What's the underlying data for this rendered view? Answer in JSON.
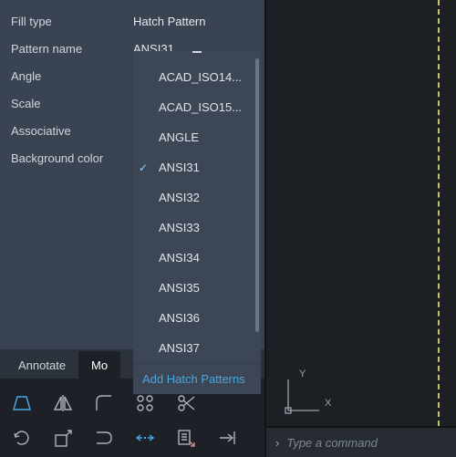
{
  "props": {
    "fill_type_label": "Fill type",
    "fill_type_value": "Hatch Pattern",
    "pattern_name_label": "Pattern name",
    "pattern_name_value": "ANSI31",
    "angle_label": "Angle",
    "scale_label": "Scale",
    "associative_label": "Associative",
    "bgcolor_label": "Background color"
  },
  "dropdown": {
    "items": [
      {
        "label": "ACAD_ISO14...",
        "selected": false
      },
      {
        "label": "ACAD_ISO15...",
        "selected": false
      },
      {
        "label": "ANGLE",
        "selected": false
      },
      {
        "label": "ANSI31",
        "selected": true
      },
      {
        "label": "ANSI32",
        "selected": false
      },
      {
        "label": "ANSI33",
        "selected": false
      },
      {
        "label": "ANSI34",
        "selected": false
      },
      {
        "label": "ANSI35",
        "selected": false
      },
      {
        "label": "ANSI36",
        "selected": false
      },
      {
        "label": "ANSI37",
        "selected": false
      }
    ],
    "footer": "Add Hatch Patterns"
  },
  "tabs": {
    "annotate": "Annotate",
    "mod": "Mo"
  },
  "ucs": {
    "x": "X",
    "y": "Y"
  },
  "cmd": {
    "placeholder": "Type a command"
  }
}
